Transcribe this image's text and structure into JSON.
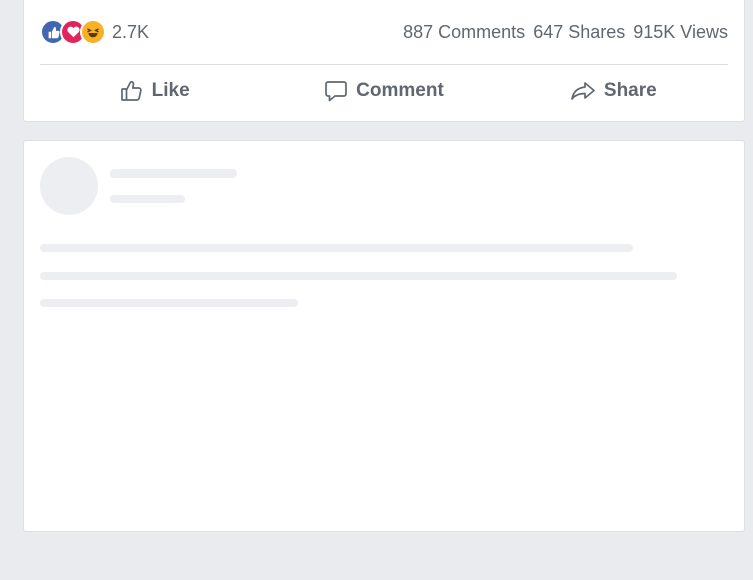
{
  "post": {
    "reactions": {
      "icons": [
        "like-reaction-icon",
        "love-reaction-icon",
        "haha-reaction-icon"
      ],
      "count": "2.7K"
    },
    "comments": "887 Comments",
    "shares": "647 Shares",
    "views": "915K Views",
    "actions": {
      "like": "Like",
      "comment": "Comment",
      "share": "Share"
    }
  },
  "colors": {
    "like": "#4267b2",
    "love": "#e0245e",
    "haha": "#f7b125",
    "text_muted": "#606770",
    "background": "#e9ebee",
    "skeleton": "#eceef1"
  }
}
